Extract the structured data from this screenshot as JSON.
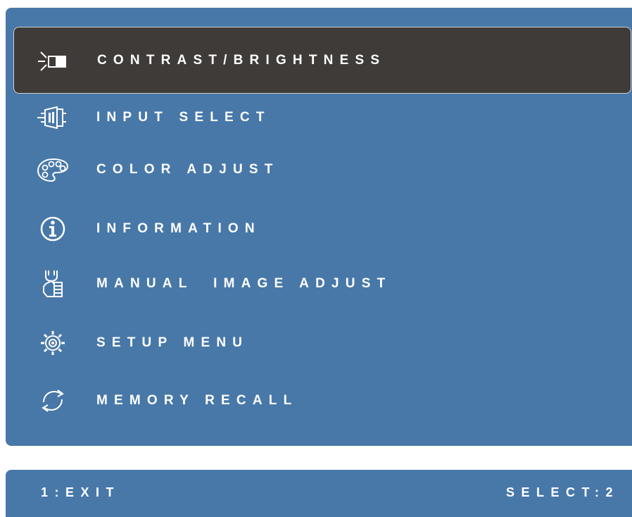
{
  "menu": {
    "items": [
      {
        "id": "contrast-brightness",
        "label": "CONTRAST/BRIGHTNESS",
        "icon": "contrast-brightness-icon",
        "selected": true
      },
      {
        "id": "input-select",
        "label": "INPUT SELECT",
        "icon": "input-connector-icon",
        "selected": false
      },
      {
        "id": "color-adjust",
        "label": "COLOR ADJUST",
        "icon": "color-palette-icon",
        "selected": false
      },
      {
        "id": "information",
        "label": "INFORMATION",
        "icon": "info-icon",
        "selected": false
      },
      {
        "id": "manual-image-adjust",
        "label": "MANUAL  IMAGE ADJUST",
        "icon": "manual-adjust-icon",
        "selected": false
      },
      {
        "id": "setup-menu",
        "label": "SETUP MENU",
        "icon": "gear-icon",
        "selected": false
      },
      {
        "id": "memory-recall",
        "label": "MEMORY RECALL",
        "icon": "recall-arrows-icon",
        "selected": false
      }
    ]
  },
  "status": {
    "left_label": "1:EXIT",
    "right_label": "SELECT:2"
  },
  "colors": {
    "panel": "#4878a8",
    "selected_row": "#3e3b39",
    "text": "#ffffff"
  }
}
